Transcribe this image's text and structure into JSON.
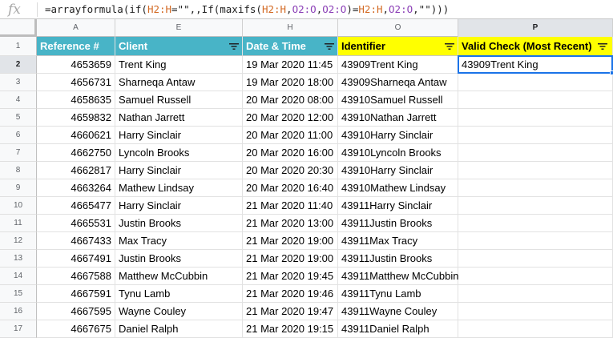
{
  "formula_bar": {
    "fx_label": "fx",
    "formula_parts": [
      "=arrayformula(if(",
      "H2:H",
      "=\"\",,If(maxifs(",
      "H2:H",
      ",",
      "O2:O",
      ",",
      "O2:O",
      ")=",
      "H2:H",
      ",",
      "O2:O",
      ",\"\")))"
    ]
  },
  "column_letters": [
    "A",
    "E",
    "H",
    "O",
    "P"
  ],
  "selected_column": "P",
  "headers": {
    "reference": "Reference #",
    "client": "Client",
    "datetime": "Date & Time",
    "identifier": "Identifier",
    "valid_check": "Valid Check (Most Recent)"
  },
  "colors": {
    "teal_header": "#48b4c7",
    "yellow_header": "#ffff00",
    "selection": "#1a73e8"
  },
  "rows": [
    {
      "num": "1"
    },
    {
      "num": "2",
      "ref": "4653659",
      "client": "Trent King",
      "datetime": "19 Mar 2020 11:45",
      "identifier": "43909Trent King",
      "valid": "43909Trent King"
    },
    {
      "num": "3",
      "ref": "4656731",
      "client": "Sharneqa Antaw",
      "datetime": "19 Mar 2020 18:00",
      "identifier": "43909Sharneqa Antaw",
      "valid": ""
    },
    {
      "num": "4",
      "ref": "4658635",
      "client": "Samuel Russell",
      "datetime": "20 Mar 2020 08:00",
      "identifier": "43910Samuel Russell",
      "valid": ""
    },
    {
      "num": "5",
      "ref": "4659832",
      "client": "Nathan Jarrett",
      "datetime": "20 Mar 2020 12:00",
      "identifier": "43910Nathan Jarrett",
      "valid": ""
    },
    {
      "num": "6",
      "ref": "4660621",
      "client": "Harry Sinclair",
      "datetime": "20 Mar 2020 11:00",
      "identifier": "43910Harry Sinclair",
      "valid": ""
    },
    {
      "num": "7",
      "ref": "4662750",
      "client": "Lyncoln Brooks",
      "datetime": "20 Mar 2020 16:00",
      "identifier": "43910Lyncoln Brooks",
      "valid": ""
    },
    {
      "num": "8",
      "ref": "4662817",
      "client": "Harry Sinclair",
      "datetime": "20 Mar 2020 20:30",
      "identifier": "43910Harry Sinclair",
      "valid": ""
    },
    {
      "num": "9",
      "ref": "4663264",
      "client": "Mathew Lindsay",
      "datetime": "20 Mar 2020 16:40",
      "identifier": "43910Mathew Lindsay",
      "valid": ""
    },
    {
      "num": "10",
      "ref": "4665477",
      "client": "Harry Sinclair",
      "datetime": "21 Mar 2020 11:40",
      "identifier": "43911Harry Sinclair",
      "valid": ""
    },
    {
      "num": "11",
      "ref": "4665531",
      "client": "Justin Brooks",
      "datetime": "21 Mar 2020 13:00",
      "identifier": "43911Justin Brooks",
      "valid": ""
    },
    {
      "num": "12",
      "ref": "4667433",
      "client": "Max Tracy",
      "datetime": "21 Mar 2020 19:00",
      "identifier": "43911Max Tracy",
      "valid": ""
    },
    {
      "num": "13",
      "ref": "4667491",
      "client": "Justin Brooks",
      "datetime": "21 Mar 2020 19:00",
      "identifier": "43911Justin Brooks",
      "valid": ""
    },
    {
      "num": "14",
      "ref": "4667588",
      "client": "Matthew McCubbin",
      "datetime": "21 Mar 2020 19:45",
      "identifier": "43911Matthew McCubbin",
      "valid": ""
    },
    {
      "num": "15",
      "ref": "4667591",
      "client": "Tynu Lamb",
      "datetime": "21 Mar 2020 19:46",
      "identifier": "43911Tynu Lamb",
      "valid": ""
    },
    {
      "num": "16",
      "ref": "4667595",
      "client": "Wayne Couley",
      "datetime": "21 Mar 2020 19:47",
      "identifier": "43911Wayne Couley",
      "valid": ""
    },
    {
      "num": "17",
      "ref": "4667675",
      "client": "Daniel Ralph",
      "datetime": "21 Mar 2020 19:15",
      "identifier": "43911Daniel Ralph",
      "valid": ""
    }
  ]
}
